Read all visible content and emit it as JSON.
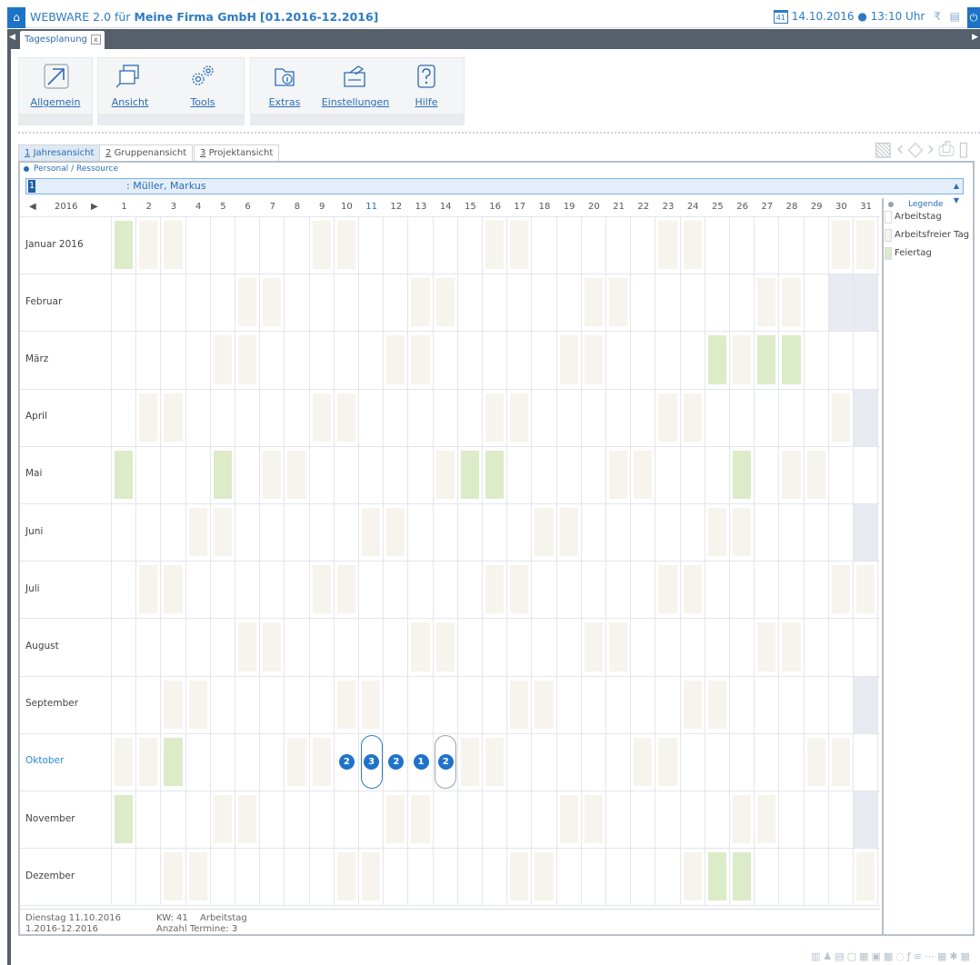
{
  "titlebar": {
    "app": "WEBWARE 2.0 für",
    "company": "Meine Firma GmbH",
    "period": "[01.2016-12.2016]",
    "cal_icon_text": "41",
    "date": "14.10.2016",
    "time": "13:10 Uhr"
  },
  "tabstrip": {
    "tab_label": "Tagesplanung",
    "close": "x"
  },
  "toolbar": {
    "allgemein": "Allgemein",
    "ansicht": "Ansicht",
    "tools": "Tools",
    "extras": "Extras",
    "einstellungen": "Einstellungen",
    "hilfe": "Hilfe"
  },
  "viewtabs": {
    "jahres_num": "1",
    "jahres": "Jahresansicht",
    "gruppen_num": "2",
    "gruppen": "Gruppenansicht",
    "projekt_num": "3",
    "projekt": "Projektansicht"
  },
  "resource": {
    "label": "Personal / Ressource",
    "number": "1",
    "name": ": Müller, Markus"
  },
  "calendar": {
    "year": "2016",
    "days": [
      "1",
      "2",
      "3",
      "4",
      "5",
      "6",
      "7",
      "8",
      "9",
      "10",
      "11",
      "12",
      "13",
      "14",
      "15",
      "16",
      "17",
      "18",
      "19",
      "20",
      "21",
      "22",
      "23",
      "24",
      "25",
      "26",
      "27",
      "28",
      "29",
      "30",
      "31"
    ],
    "today_day": 11,
    "months": [
      {
        "name": "Januar 2016",
        "days": 31,
        "weekends": [
          2,
          3,
          9,
          10,
          16,
          17,
          23,
          24,
          30,
          31
        ],
        "holidays": [
          1
        ]
      },
      {
        "name": "Februar",
        "days": 29,
        "weekends": [
          6,
          7,
          13,
          14,
          20,
          21,
          27,
          28
        ],
        "holidays": []
      },
      {
        "name": "März",
        "days": 31,
        "weekends": [
          5,
          6,
          12,
          13,
          19,
          20,
          26,
          27
        ],
        "holidays": [
          25,
          27,
          28
        ]
      },
      {
        "name": "April",
        "days": 30,
        "weekends": [
          2,
          3,
          9,
          10,
          16,
          17,
          23,
          24,
          30
        ],
        "holidays": []
      },
      {
        "name": "Mai",
        "days": 31,
        "weekends": [
          7,
          8,
          14,
          15,
          21,
          22,
          28,
          29
        ],
        "holidays": [
          1,
          5,
          15,
          16,
          26
        ]
      },
      {
        "name": "Juni",
        "days": 30,
        "weekends": [
          4,
          5,
          11,
          12,
          18,
          19,
          25,
          26
        ],
        "holidays": []
      },
      {
        "name": "Juli",
        "days": 31,
        "weekends": [
          2,
          3,
          9,
          10,
          16,
          17,
          23,
          24,
          30,
          31
        ],
        "holidays": []
      },
      {
        "name": "August",
        "days": 31,
        "weekends": [
          6,
          7,
          13,
          14,
          20,
          21,
          27,
          28
        ],
        "holidays": []
      },
      {
        "name": "September",
        "days": 30,
        "weekends": [
          3,
          4,
          10,
          11,
          17,
          18,
          24,
          25
        ],
        "holidays": []
      },
      {
        "name": "Oktober",
        "days": 31,
        "weekends": [
          1,
          2,
          8,
          9,
          15,
          16,
          22,
          23,
          29,
          30
        ],
        "holidays": [
          3
        ],
        "current": true
      },
      {
        "name": "November",
        "days": 30,
        "weekends": [
          5,
          6,
          12,
          13,
          19,
          20,
          26,
          27
        ],
        "holidays": [
          1
        ]
      },
      {
        "name": "Dezember",
        "days": 31,
        "weekends": [
          3,
          4,
          10,
          11,
          17,
          18,
          24,
          31
        ],
        "holidays": [
          25,
          26
        ]
      }
    ],
    "appointments": [
      {
        "month": 10,
        "day": 10,
        "count": "2"
      },
      {
        "month": 10,
        "day": 11,
        "count": "3",
        "selected": true
      },
      {
        "month": 10,
        "day": 12,
        "count": "2"
      },
      {
        "month": 10,
        "day": 13,
        "count": "1"
      },
      {
        "month": 10,
        "day": 14,
        "count": "2",
        "today": true
      }
    ]
  },
  "legend": {
    "title": "Legende",
    "items": [
      "Arbeitstag",
      "Arbeitsfreier Tag",
      "Feiertag"
    ],
    "colors": {
      "arbeitstag": "#ffffff",
      "frei": "#f6f4ec",
      "feiertag": "#dcebc8"
    }
  },
  "footer": {
    "date": "Dienstag 11.10.2016",
    "kw": "KW: 41",
    "type": "Arbeitstag",
    "period": "1.2016-12.2016",
    "termine": "Anzahl Termine: 3"
  }
}
